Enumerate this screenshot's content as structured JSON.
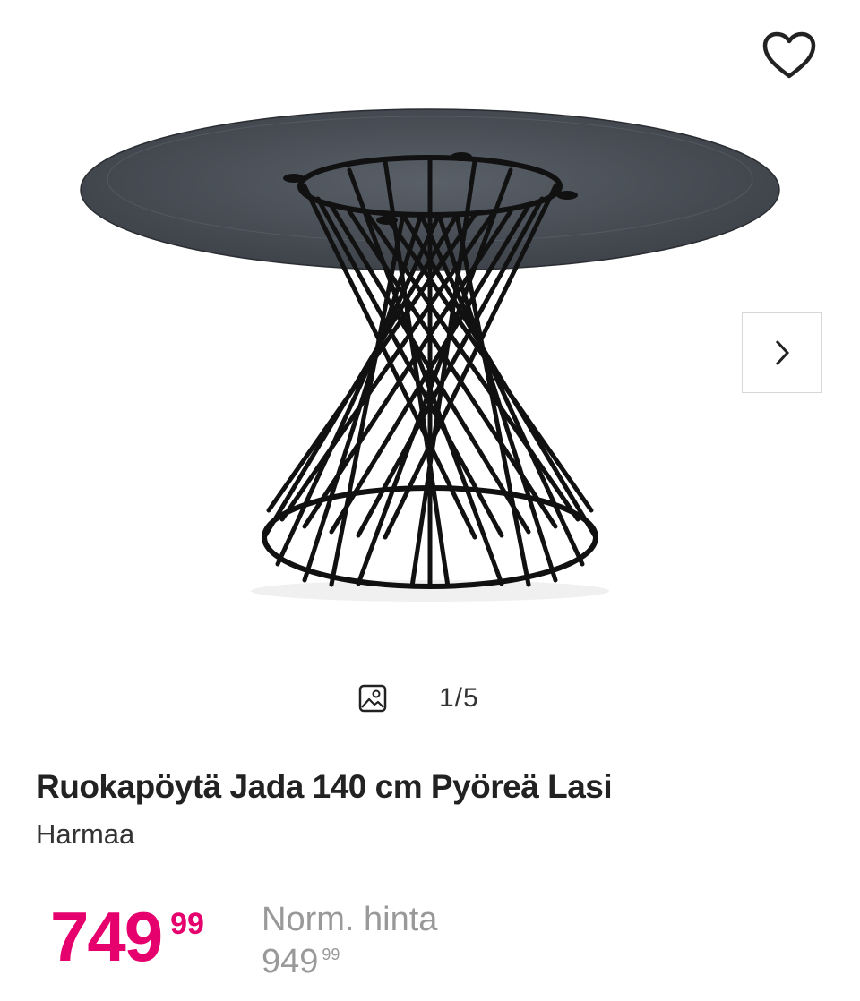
{
  "gallery": {
    "image_alt": "Ruokapöytä Jada 140 cm Pyöreä Lasi",
    "counter": "1/5",
    "favorite_icon": "heart-outline-icon",
    "next_icon": "chevron-right-icon",
    "gallery_icon": "image-icon"
  },
  "product": {
    "title": "Ruokapöytä Jada 140 cm Pyöreä Lasi",
    "variant": "Harmaa"
  },
  "price": {
    "main": "749",
    "cents": "99",
    "color": "#e5006d"
  },
  "normal_price": {
    "label": "Norm. hinta",
    "main": "949",
    "cents": "99"
  }
}
